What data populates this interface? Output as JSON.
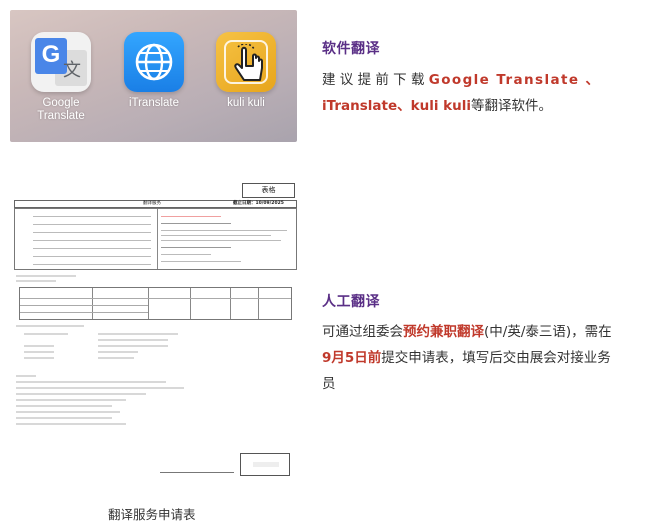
{
  "apps": [
    {
      "name_line1": "Google",
      "name_line2": "Translate",
      "icon": "google-translate-icon"
    },
    {
      "name_line1": "iTranslate",
      "icon": "itranslate-globe-icon"
    },
    {
      "name_line1": "kuli kuli",
      "icon": "kuli-kuli-hand-icon"
    }
  ],
  "software": {
    "title": "软件翻译",
    "para_line1_prefix": "建 议 提 前 下 载 ",
    "para_line1_highlight": "Google  Translate 、",
    "para_line2_highlight": "iTranslate、kuli kuli",
    "para_line2_suffix": "等翻译软件。"
  },
  "human": {
    "title": "人工翻译",
    "line1_prefix": "可通过组委会",
    "line1_highlight": "预约兼职翻译",
    "line1_suffix": "(中/英/泰三语)，需在",
    "line2_highlight": "9月5日前",
    "line2_suffix": "提交申请表，填写后交由展会对接业务",
    "line3": "员"
  },
  "form": {
    "tag": "表格",
    "bar_title": "翻译服务",
    "bar_date": "截止日期：10/09/2025",
    "caption": "翻译服务申请表"
  },
  "colors": {
    "title": "#5a2f86",
    "highlight": "#c0392b"
  }
}
